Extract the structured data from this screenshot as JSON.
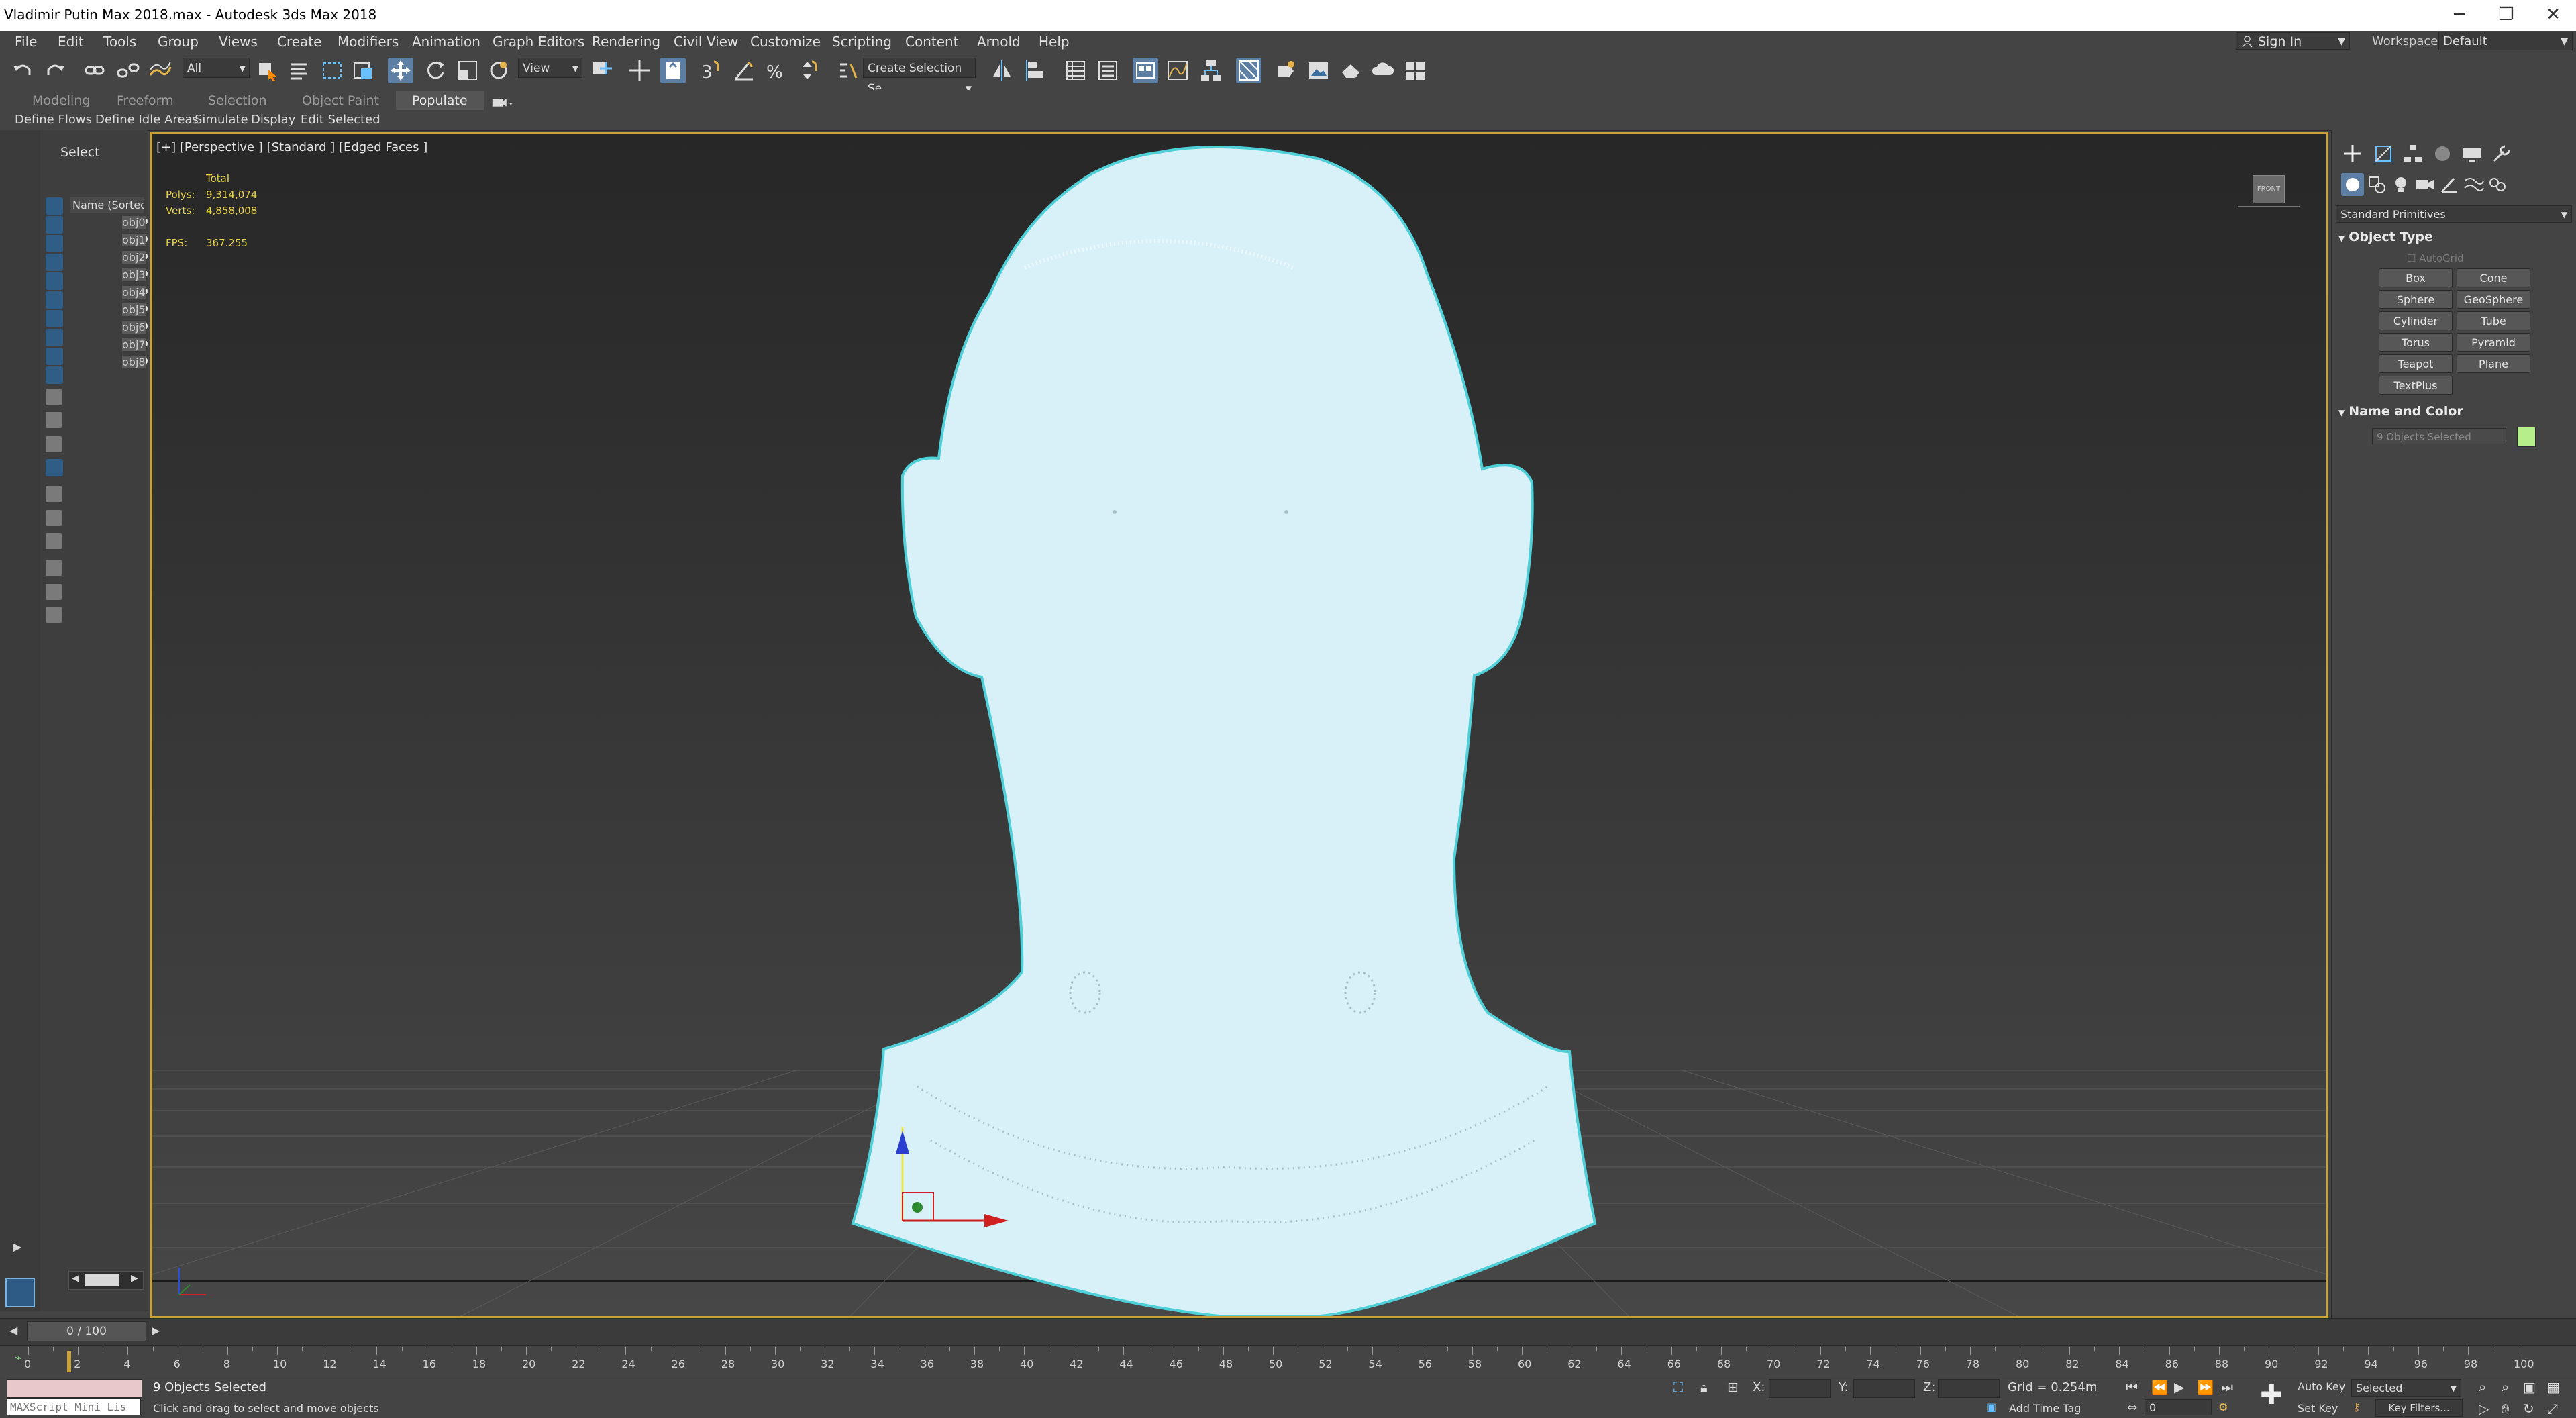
{
  "window": {
    "title": "Vladimir Putin Max 2018.max - Autodesk 3ds Max 2018",
    "minimize": "─",
    "restore": "❐",
    "close": "✕"
  },
  "menu": [
    "File",
    "Edit",
    "Tools",
    "Group",
    "Views",
    "Create",
    "Modifiers",
    "Animation",
    "Graph Editors",
    "Rendering",
    "Civil View",
    "Customize",
    "Scripting",
    "Content",
    "Arnold",
    "Help"
  ],
  "signin": "Sign In",
  "workspaces": {
    "label": "Workspaces:",
    "value": "Default"
  },
  "toolbar": {
    "filter": "All",
    "coord": "View",
    "selection_set": "Create Selection Se"
  },
  "ribbon": {
    "tabs": [
      "Modeling",
      "Freeform",
      "Selection",
      "Object Paint",
      "Populate"
    ],
    "active_tab": "Populate",
    "subtabs": [
      "Define Flows",
      "Define Idle Areas",
      "Simulate",
      "Display",
      "Edit Selected"
    ]
  },
  "scene_explorer": {
    "title": "Select",
    "column": "Name (Sorted A",
    "objects": [
      "obj0",
      "obj1",
      "obj2",
      "obj3",
      "obj4",
      "obj5",
      "obj6",
      "obj7",
      "obj8"
    ]
  },
  "viewport": {
    "label": "[+] [Perspective ] [Standard ] [Edged Faces ]",
    "stats": {
      "total_label": "Total",
      "polys_label": "Polys:",
      "polys": "9,314,074",
      "verts_label": "Verts:",
      "verts": "4,858,008",
      "fps_label": "FPS:",
      "fps": "367.255"
    },
    "viewcube": "FRONT",
    "model_color": "#d8f0f8",
    "outline_color": "#4fd0d8"
  },
  "command_panel": {
    "category": "Standard Primitives",
    "object_type": "Object Type",
    "autogrid": "AutoGrid",
    "buttons": [
      "Box",
      "Cone",
      "Sphere",
      "GeoSphere",
      "Cylinder",
      "Tube",
      "Torus",
      "Pyramid",
      "Teapot",
      "Plane",
      "TextPlus"
    ],
    "name_and_color": "Name and Color",
    "name_field": "9 Objects Selected",
    "color_swatch": "#b6ee8a"
  },
  "timeline": {
    "frame_display": "0 / 100",
    "ticks": [
      "0",
      "2",
      "4",
      "6",
      "8",
      "10",
      "12",
      "14",
      "16",
      "18",
      "20",
      "22",
      "24",
      "26",
      "28",
      "30",
      "32",
      "34",
      "36",
      "38",
      "40",
      "42",
      "44",
      "46",
      "48",
      "50",
      "52",
      "54",
      "56",
      "58",
      "60",
      "62",
      "64",
      "66",
      "68",
      "70",
      "72",
      "74",
      "76",
      "78",
      "80",
      "82",
      "84",
      "86",
      "88",
      "90",
      "92",
      "94",
      "96",
      "98",
      "100"
    ]
  },
  "status": {
    "maxscript": "MAXScript Mini Lis",
    "selection": "9 Objects Selected",
    "prompt": "Click and drag to select and move objects",
    "x_label": "X:",
    "y_label": "Y:",
    "z_label": "Z:",
    "grid": "Grid = 0.254m",
    "add_time_tag": "Add Time Tag",
    "auto_key": "Auto Key",
    "selected": "Selected",
    "set_key": "Set Key",
    "key_filters": "Key Filters...",
    "frame": "0"
  }
}
